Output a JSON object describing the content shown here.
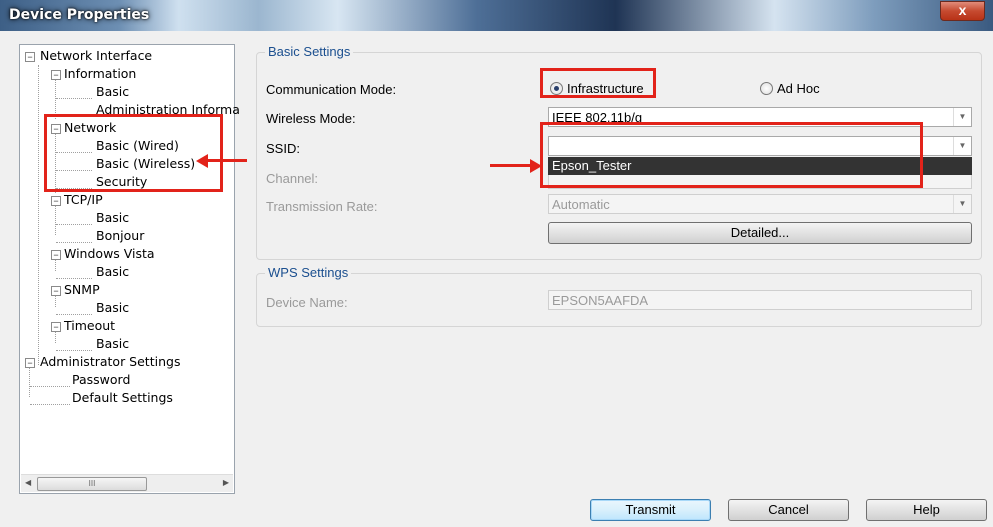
{
  "window": {
    "title": "Device Properties",
    "close_glyph": "x"
  },
  "tree": {
    "network_interface": "Network Interface",
    "information": "Information",
    "info_basic": "Basic",
    "admin_info": "Administration Informa",
    "network": "Network",
    "basic_wired": "Basic (Wired)",
    "basic_wireless": "Basic (Wireless)",
    "security": "Security",
    "tcpip": "TCP/IP",
    "tcpip_basic": "Basic",
    "bonjour": "Bonjour",
    "windows_vista": "Windows Vista",
    "vista_basic": "Basic",
    "snmp": "SNMP",
    "snmp_basic": "Basic",
    "timeout": "Timeout",
    "timeout_basic": "Basic",
    "admin_settings": "Administrator Settings",
    "password": "Password",
    "default_settings": "Default Settings",
    "expander_glyph": "−",
    "scroll_thumb_glyph": "III",
    "scroll_left_glyph": "◀",
    "scroll_right_glyph": "▶"
  },
  "basic_settings": {
    "title": "Basic Settings",
    "comm_mode_label": "Communication Mode:",
    "infrastructure": "Infrastructure",
    "adhoc": "Ad Hoc",
    "selected_mode": "Infrastructure",
    "wireless_mode_label": "Wireless Mode:",
    "wireless_mode_value": "IEEE 802.11b/g",
    "ssid_label": "SSID:",
    "ssid_value": "",
    "ssid_option": "Epson_Tester",
    "channel_label": "Channel:",
    "channel_value": "",
    "tx_rate_label": "Transmission Rate:",
    "tx_rate_value": "Automatic",
    "detailed_button": "Detailed...",
    "dropdown_arrow": "▼"
  },
  "wps_settings": {
    "title": "WPS Settings",
    "device_name_label": "Device Name:",
    "device_name_value": "EPSON5AAFDA"
  },
  "footer": {
    "transmit": "Transmit",
    "cancel": "Cancel",
    "help": "Help"
  },
  "colors": {
    "annotation_red": "#e2231a",
    "group_title_blue": "#1b4f8f"
  }
}
